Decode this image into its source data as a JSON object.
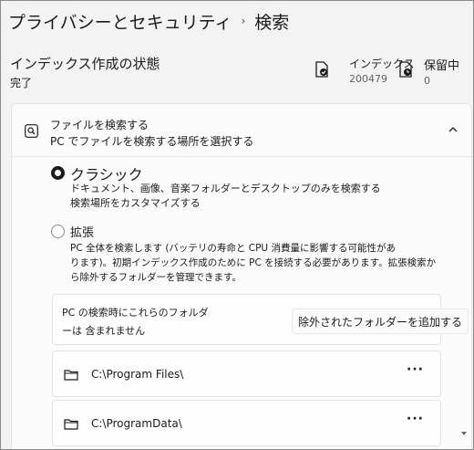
{
  "breadcrumb": {
    "parent": "プライバシーとセキュリティ",
    "separator": "›",
    "current": "検索"
  },
  "indexing": {
    "title": "インデックス作成の状態",
    "status": "完了",
    "indexed_label": "インデックス",
    "indexed_count": "200479",
    "pending_label": "保留中",
    "pending_count": "0"
  },
  "find_files": {
    "title": "ファイルを検索する",
    "subtitle": "PC でファイルを検索する場所を選択する",
    "classic": {
      "label": "クラシック",
      "desc_1": "ドキュメント、画像、音楽フォルダーとデスクトップのみを検索する",
      "desc_2": "検索場所をカスタマイズする"
    },
    "enhanced": {
      "label": "拡張",
      "desc_1": "PC 全体を検索します (バッテリの寿命と CPU 消費量に影響する可能性があ",
      "desc_2": "ります)。初期インデックス作成のために PC を接続する必要があります。拡張検索か",
      "desc_3": "ら除外するフォルダーを管理できます。"
    }
  },
  "excluded": {
    "text_1": "PC の検索時にこれらのフォルダ",
    "text_2": "ーは 含まれません",
    "add_button": "除外されたフォルダーを追加する",
    "folders": [
      {
        "path": "C:\\Program Files\\"
      },
      {
        "path": "C:\\ProgramData\\"
      }
    ],
    "more_glyph": "···"
  }
}
